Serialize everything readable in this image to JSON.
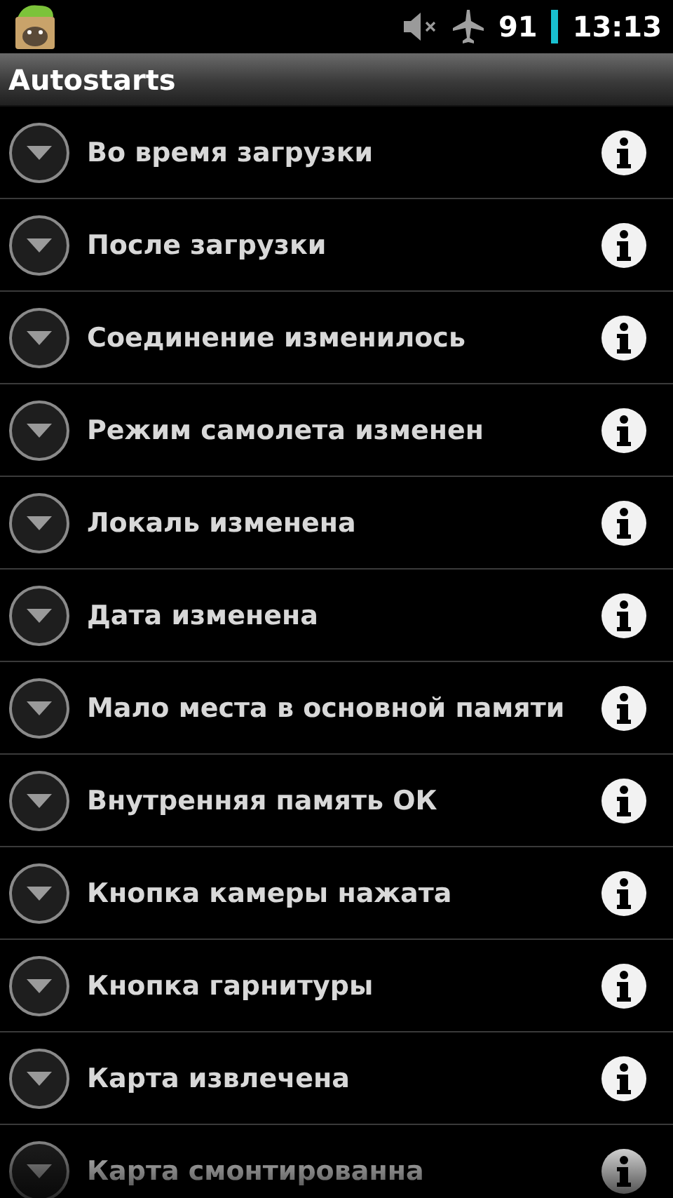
{
  "status_bar": {
    "battery": "91",
    "time": "13:13"
  },
  "title_bar": {
    "title": "Autostarts"
  },
  "items": [
    {
      "label": "Во время загрузки"
    },
    {
      "label": "После загрузки"
    },
    {
      "label": "Соединение изменилось"
    },
    {
      "label": "Режим самолета изменен"
    },
    {
      "label": "Локаль изменена"
    },
    {
      "label": "Дата изменена"
    },
    {
      "label": "Мало места в основной памяти"
    },
    {
      "label": "Внутренняя память ОК"
    },
    {
      "label": "Кнопка камеры нажата"
    },
    {
      "label": "Кнопка гарнитуры"
    },
    {
      "label": "Карта извлечена"
    },
    {
      "label": "Карта смонтированна"
    }
  ]
}
